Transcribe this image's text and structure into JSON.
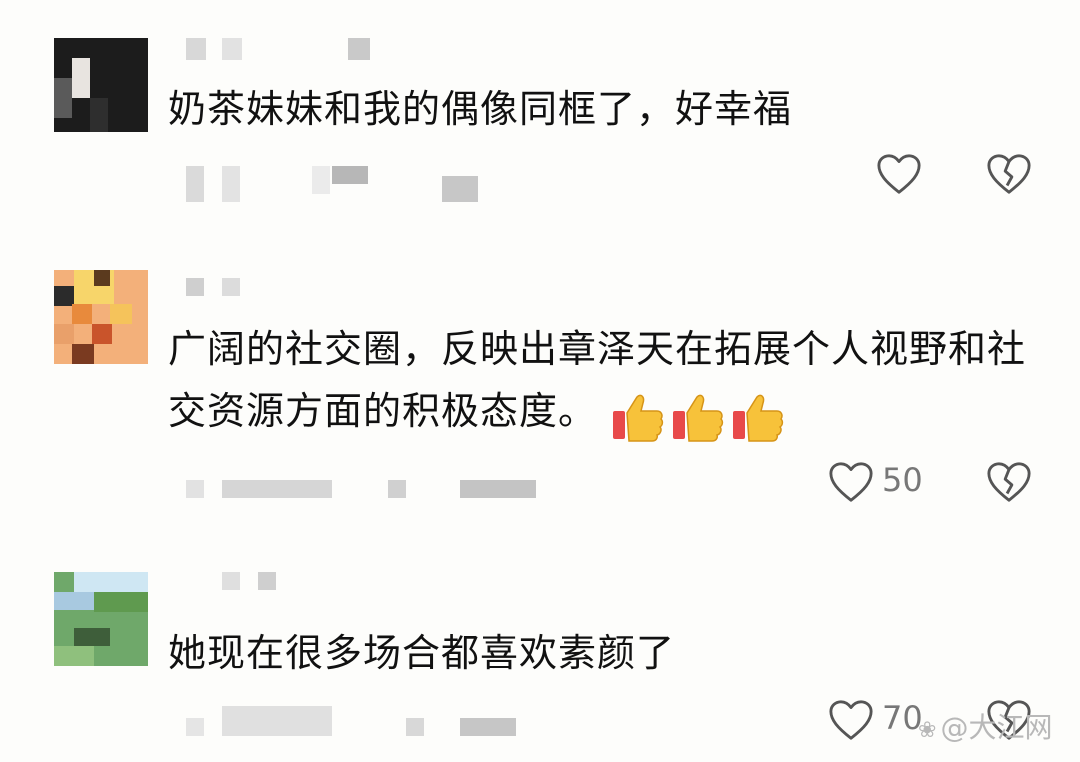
{
  "comments": [
    {
      "text": "奶茶妹妹和我的偶像同框了，好幸福",
      "likes": ""
    },
    {
      "text": "广阔的社交圈，反映出章泽天在拓展个人视野和社交资源方面的积极态度。",
      "likes": "50"
    },
    {
      "text": "她现在很多场合都喜欢素颜了",
      "likes": "70"
    }
  ],
  "icons": {
    "like": "heart-outline-icon",
    "dislike": "broken-heart-icon",
    "emoji": "thumbs-up-emoji"
  },
  "watermark": "@大江网"
}
